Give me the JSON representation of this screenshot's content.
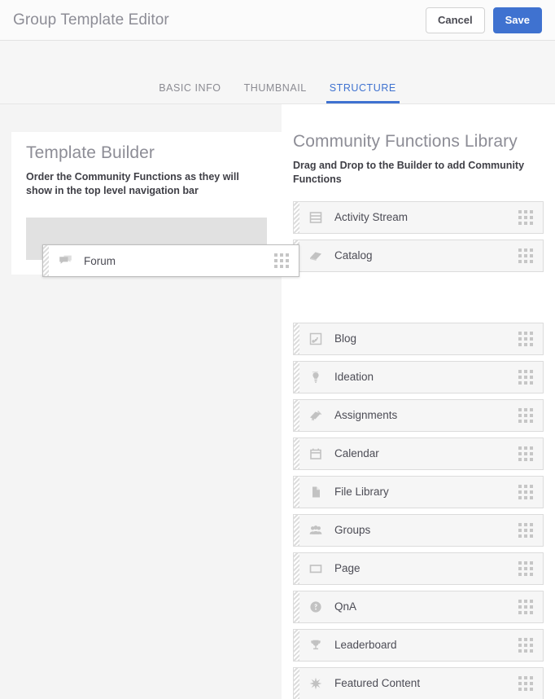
{
  "header": {
    "title": "Group Template Editor",
    "cancel_label": "Cancel",
    "save_label": "Save",
    "accent_color": "#3f72d0"
  },
  "tabs": [
    {
      "label": "BASIC INFO",
      "active": false
    },
    {
      "label": "THUMBNAIL",
      "active": false
    },
    {
      "label": "STRUCTURE",
      "active": true
    }
  ],
  "builder": {
    "title": "Template Builder",
    "instructions": "Order the Community Functions as they will show in the top level navigation bar",
    "items": []
  },
  "library": {
    "title": "Community Functions Library",
    "instructions": "Drag and Drop to the Builder to add Community Functions",
    "items": [
      {
        "label": "Activity Stream",
        "icon": "activity-stream-icon"
      },
      {
        "label": "Catalog",
        "icon": "catalog-icon"
      },
      {
        "label": "Blog",
        "icon": "blog-icon"
      },
      {
        "label": "Ideation",
        "icon": "lightbulb-icon"
      },
      {
        "label": "Assignments",
        "icon": "assignments-icon"
      },
      {
        "label": "Calendar",
        "icon": "calendar-icon"
      },
      {
        "label": "File Library",
        "icon": "file-icon"
      },
      {
        "label": "Groups",
        "icon": "groups-icon"
      },
      {
        "label": "Page",
        "icon": "page-icon"
      },
      {
        "label": "QnA",
        "icon": "question-mark-icon"
      },
      {
        "label": "Leaderboard",
        "icon": "trophy-icon"
      },
      {
        "label": "Featured Content",
        "icon": "starburst-icon"
      }
    ]
  },
  "dragging": {
    "label": "Forum",
    "icon": "chat-bubble-icon"
  }
}
